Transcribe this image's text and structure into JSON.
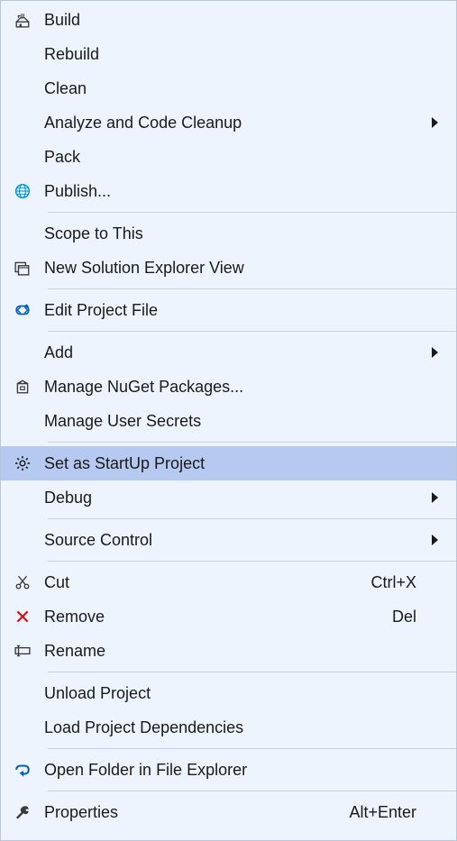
{
  "menu": {
    "items": [
      {
        "id": "build",
        "label": "Build",
        "icon": "build-icon",
        "hasSubmenu": false,
        "shortcut": ""
      },
      {
        "id": "rebuild",
        "label": "Rebuild",
        "icon": "",
        "hasSubmenu": false,
        "shortcut": ""
      },
      {
        "id": "clean",
        "label": "Clean",
        "icon": "",
        "hasSubmenu": false,
        "shortcut": ""
      },
      {
        "id": "analyze",
        "label": "Analyze and Code Cleanup",
        "icon": "",
        "hasSubmenu": true,
        "shortcut": ""
      },
      {
        "id": "pack",
        "label": "Pack",
        "icon": "",
        "hasSubmenu": false,
        "shortcut": ""
      },
      {
        "id": "publish",
        "label": "Publish...",
        "icon": "publish-icon",
        "hasSubmenu": false,
        "shortcut": ""
      },
      {
        "type": "separator"
      },
      {
        "id": "scope",
        "label": "Scope to This",
        "icon": "",
        "hasSubmenu": false,
        "shortcut": ""
      },
      {
        "id": "newview",
        "label": "New Solution Explorer View",
        "icon": "new-view-icon",
        "hasSubmenu": false,
        "shortcut": ""
      },
      {
        "type": "separator"
      },
      {
        "id": "editproj",
        "label": "Edit Project File",
        "icon": "edit-proj-icon",
        "hasSubmenu": false,
        "shortcut": ""
      },
      {
        "type": "separator"
      },
      {
        "id": "add",
        "label": "Add",
        "icon": "",
        "hasSubmenu": true,
        "shortcut": ""
      },
      {
        "id": "nuget",
        "label": "Manage NuGet Packages...",
        "icon": "nuget-icon",
        "hasSubmenu": false,
        "shortcut": ""
      },
      {
        "id": "secrets",
        "label": "Manage User Secrets",
        "icon": "",
        "hasSubmenu": false,
        "shortcut": ""
      },
      {
        "type": "separator"
      },
      {
        "id": "startup",
        "label": "Set as StartUp Project",
        "icon": "gear-icon",
        "hasSubmenu": false,
        "shortcut": "",
        "highlighted": true
      },
      {
        "id": "debug",
        "label": "Debug",
        "icon": "",
        "hasSubmenu": true,
        "shortcut": ""
      },
      {
        "type": "separator"
      },
      {
        "id": "sourcecontrol",
        "label": "Source Control",
        "icon": "",
        "hasSubmenu": true,
        "shortcut": ""
      },
      {
        "type": "separator"
      },
      {
        "id": "cut",
        "label": "Cut",
        "icon": "cut-icon",
        "hasSubmenu": false,
        "shortcut": "Ctrl+X"
      },
      {
        "id": "remove",
        "label": "Remove",
        "icon": "remove-icon",
        "hasSubmenu": false,
        "shortcut": "Del"
      },
      {
        "id": "rename",
        "label": "Rename",
        "icon": "rename-icon",
        "hasSubmenu": false,
        "shortcut": ""
      },
      {
        "type": "separator"
      },
      {
        "id": "unload",
        "label": "Unload Project",
        "icon": "",
        "hasSubmenu": false,
        "shortcut": ""
      },
      {
        "id": "loaddeps",
        "label": "Load Project Dependencies",
        "icon": "",
        "hasSubmenu": false,
        "shortcut": ""
      },
      {
        "type": "separator"
      },
      {
        "id": "openfolder",
        "label": "Open Folder in File Explorer",
        "icon": "open-folder-icon",
        "hasSubmenu": false,
        "shortcut": ""
      },
      {
        "type": "separator"
      },
      {
        "id": "properties",
        "label": "Properties",
        "icon": "wrench-icon",
        "hasSubmenu": false,
        "shortcut": "Alt+Enter"
      }
    ]
  }
}
